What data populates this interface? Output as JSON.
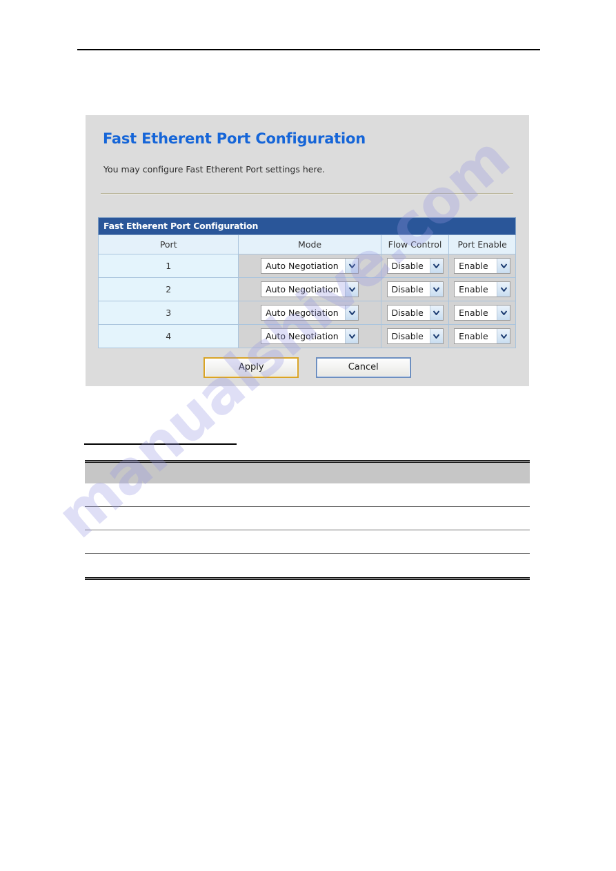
{
  "document": {
    "top_rule": true,
    "watermark_text": "manualshive.com"
  },
  "panel": {
    "title": "Fast Etherent Port Configuration",
    "description": "You may configure Fast Etherent Port settings here.",
    "accent_color": "#1565d8",
    "background_color": "#dcdcdc",
    "header_bar_color": "#2a5699"
  },
  "config_table": {
    "caption": "Fast Etherent Port Configuration",
    "columns": [
      "Port",
      "Mode",
      "Flow Control",
      "Port Enable"
    ],
    "rows": [
      {
        "port": "1",
        "mode": "Auto Negotiation",
        "flow_control": "Disable",
        "port_enable": "Enable"
      },
      {
        "port": "2",
        "mode": "Auto Negotiation",
        "flow_control": "Disable",
        "port_enable": "Enable"
      },
      {
        "port": "3",
        "mode": "Auto Negotiation",
        "flow_control": "Disable",
        "port_enable": "Enable"
      },
      {
        "port": "4",
        "mode": "Auto Negotiation",
        "flow_control": "Disable",
        "port_enable": "Enable"
      }
    ]
  },
  "buttons": {
    "apply_label": "Apply",
    "cancel_label": "Cancel",
    "apply_border_color": "#d9a426",
    "cancel_border_color": "#6d8fc0"
  },
  "lower_table": {
    "header_band_color": "#c6c6c6",
    "row_count": 4
  }
}
